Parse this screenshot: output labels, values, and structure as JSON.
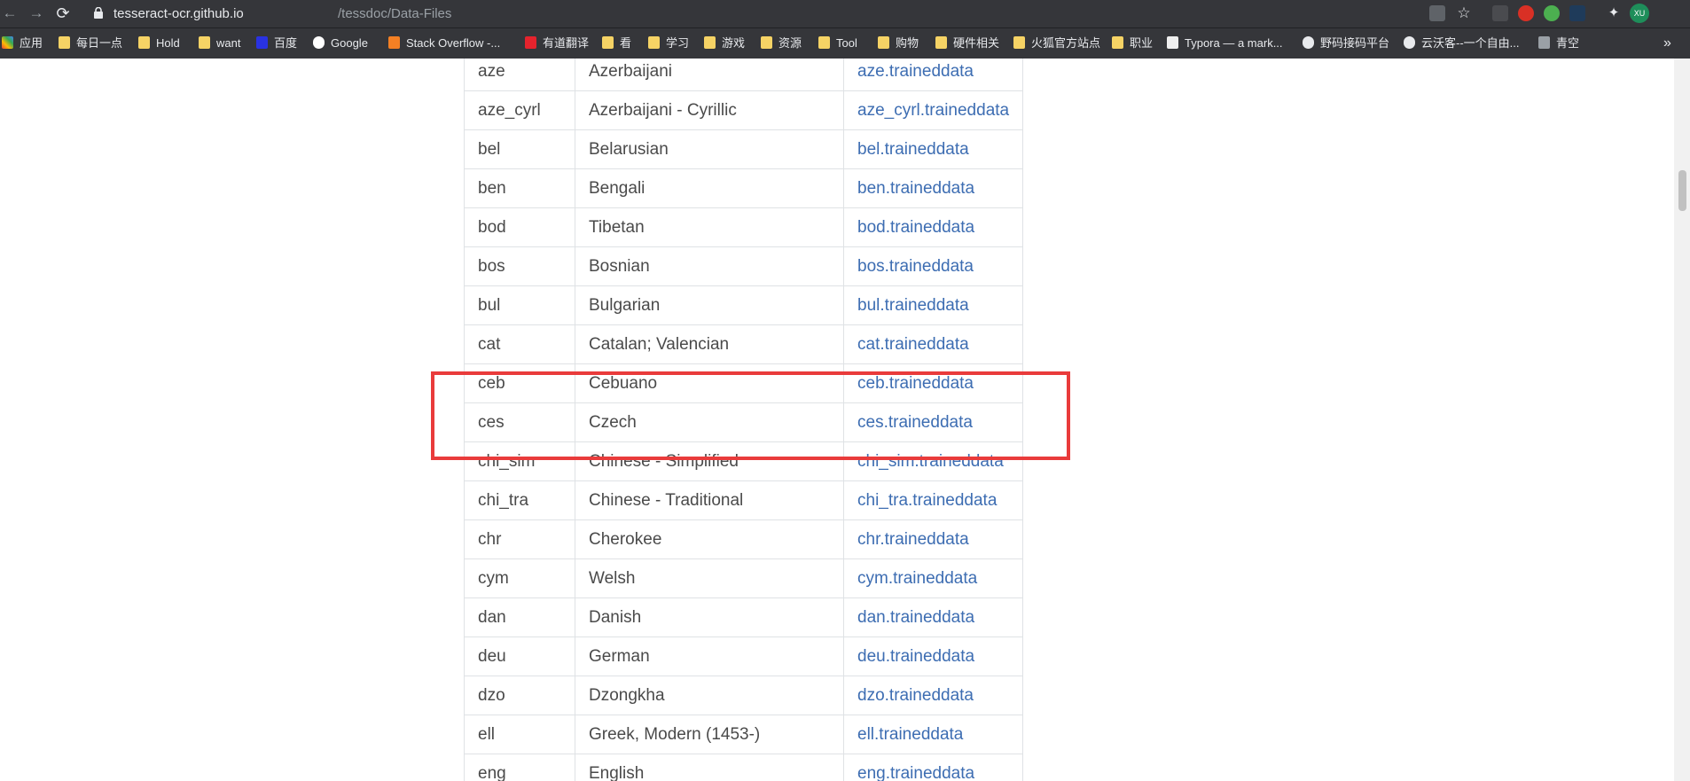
{
  "browser": {
    "url_host": "tesseract-ocr.github.io",
    "url_path": "/tessdoc/Data-Files",
    "profile_initials": "XU",
    "bookmarks": [
      {
        "label": "应用",
        "icon": "apps-grid-icon"
      },
      {
        "label": "每日一点",
        "icon": "folder-icon"
      },
      {
        "label": "Hold",
        "icon": "folder-icon"
      },
      {
        "label": "want",
        "icon": "folder-icon"
      },
      {
        "label": "百度",
        "icon": "baidu-icon"
      },
      {
        "label": "Google",
        "icon": "google-icon"
      },
      {
        "label": "Stack Overflow -...",
        "icon": "stackoverflow-icon"
      },
      {
        "label": "有道翻译",
        "icon": "youdao-icon"
      },
      {
        "label": "看",
        "icon": "folder-icon"
      },
      {
        "label": "学习",
        "icon": "folder-icon"
      },
      {
        "label": "游戏",
        "icon": "folder-icon"
      },
      {
        "label": "资源",
        "icon": "folder-icon"
      },
      {
        "label": "Tool",
        "icon": "folder-icon"
      },
      {
        "label": "购物",
        "icon": "folder-icon"
      },
      {
        "label": "硬件相关",
        "icon": "folder-icon"
      },
      {
        "label": "火狐官方站点",
        "icon": "folder-icon"
      },
      {
        "label": "职业",
        "icon": "folder-icon"
      },
      {
        "label": "Typora — a mark...",
        "icon": "typora-icon"
      },
      {
        "label": "野码接码平台",
        "icon": "globe-icon"
      },
      {
        "label": "云沃客--一个自由...",
        "icon": "globe-icon"
      },
      {
        "label": "青空",
        "icon": "vuetify-icon"
      }
    ],
    "overflow_label": "»"
  },
  "table": {
    "rows": [
      {
        "code": "aze",
        "language": "Azerbaijani",
        "file": "aze.traineddata"
      },
      {
        "code": "aze_cyrl",
        "language": "Azerbaijani - Cyrillic",
        "file": "aze_cyrl.traineddata"
      },
      {
        "code": "bel",
        "language": "Belarusian",
        "file": "bel.traineddata"
      },
      {
        "code": "ben",
        "language": "Bengali",
        "file": "ben.traineddata"
      },
      {
        "code": "bod",
        "language": "Tibetan",
        "file": "bod.traineddata"
      },
      {
        "code": "bos",
        "language": "Bosnian",
        "file": "bos.traineddata"
      },
      {
        "code": "bul",
        "language": "Bulgarian",
        "file": "bul.traineddata"
      },
      {
        "code": "cat",
        "language": "Catalan; Valencian",
        "file": "cat.traineddata"
      },
      {
        "code": "ceb",
        "language": "Cebuano",
        "file": "ceb.traineddata"
      },
      {
        "code": "ces",
        "language": "Czech",
        "file": "ces.traineddata"
      },
      {
        "code": "chi_sim",
        "language": "Chinese - Simplified",
        "file": "chi_sim.traineddata"
      },
      {
        "code": "chi_tra",
        "language": "Chinese - Traditional",
        "file": "chi_tra.traineddata"
      },
      {
        "code": "chr",
        "language": "Cherokee",
        "file": "chr.traineddata"
      },
      {
        "code": "cym",
        "language": "Welsh",
        "file": "cym.traineddata"
      },
      {
        "code": "dan",
        "language": "Danish",
        "file": "dan.traineddata"
      },
      {
        "code": "deu",
        "language": "German",
        "file": "deu.traineddata"
      },
      {
        "code": "dzo",
        "language": "Dzongkha",
        "file": "dzo.traineddata"
      },
      {
        "code": "ell",
        "language": "Greek, Modern (1453-)",
        "file": "ell.traineddata"
      },
      {
        "code": "eng",
        "language": "English",
        "file": "eng.traineddata"
      }
    ]
  },
  "colors": {
    "chrome_bg": "#35363a",
    "link": "#3d6db2",
    "highlight": "#e93b3b"
  }
}
